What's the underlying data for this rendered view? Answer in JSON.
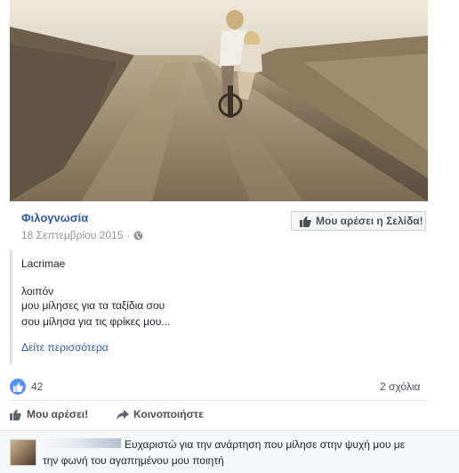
{
  "post": {
    "page_name": "Φιλογνωσία",
    "date": "18 Σεπτεμβρίου 2015",
    "dot": "·",
    "privacy_icon": "globe-icon",
    "like_page_label": "Μου αρέσει η Σελίδα!",
    "title_line": "Lacrimae",
    "lines": [
      "λοιπόν",
      "μου μίλησες για τα ταξίδια σου",
      "σου μίλησα για τις φρίκες μου..."
    ],
    "see_more": "Δείτε περισσότερα"
  },
  "stats": {
    "likes": "42",
    "comments": "2 σχόλια",
    "like_icon": "thumbs-up-icon"
  },
  "actions": {
    "like": "Μου αρέσει!",
    "share": "Κοινοποιήστε"
  },
  "comment": {
    "text": "Ευχαριστώ για την ανάρτηση που μίλησε στην ψυχή μου με την φωνή του αγαπημένου μου ποιητή"
  },
  "colors": {
    "link": "#365899",
    "like_blue": "#5890ff",
    "meta_gray": "#90949c"
  }
}
